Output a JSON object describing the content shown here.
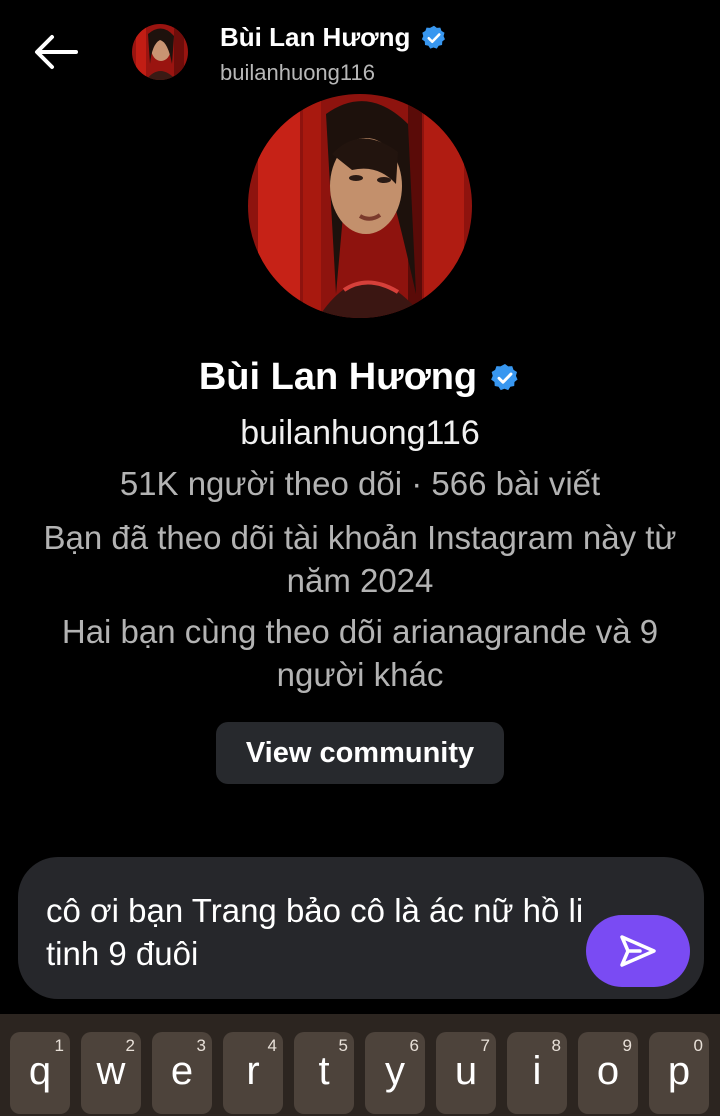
{
  "header": {
    "back_icon": "arrow-left-icon",
    "name": "Bùi Lan Hương",
    "username": "builanhuong116",
    "verified_icon": "verified-badge-icon"
  },
  "profile": {
    "name": "Bùi Lan Hương",
    "username": "builanhuong116",
    "stats": "51K người theo dõi · 566 bài viết",
    "follow_since": "Bạn đã theo dõi tài khoản Instagram này từ năm 2024",
    "mutual": "Hai bạn cùng theo dõi arianagrande và 9 người khác",
    "community_button": "View community"
  },
  "composer": {
    "text": "cô ơi bạn Trang bảo cô là ác nữ hồ li tinh 9 đuôi",
    "send_icon": "send-icon",
    "send_color": "#7a4bf3"
  },
  "keyboard": {
    "keys": [
      {
        "char": "q",
        "num": "1"
      },
      {
        "char": "w",
        "num": "2"
      },
      {
        "char": "e",
        "num": "3"
      },
      {
        "char": "r",
        "num": "4"
      },
      {
        "char": "t",
        "num": "5"
      },
      {
        "char": "y",
        "num": "6"
      },
      {
        "char": "u",
        "num": "7"
      },
      {
        "char": "i",
        "num": "8"
      },
      {
        "char": "o",
        "num": "9"
      },
      {
        "char": "p",
        "num": "0"
      }
    ]
  },
  "colors": {
    "background": "#000000",
    "verified": "#3897f0",
    "accent": "#7a4bf3"
  }
}
